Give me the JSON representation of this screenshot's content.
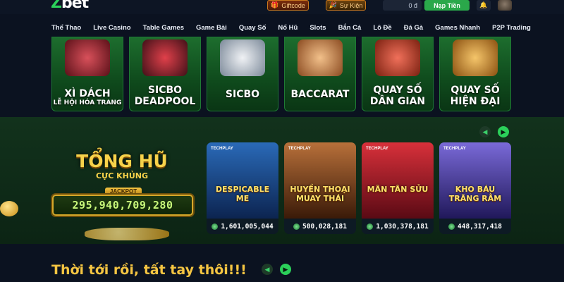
{
  "header": {
    "logo_prefix": "Z",
    "logo_text": "bet",
    "giftcode_label": "Giftcode",
    "sukien_label": "Sự Kiện",
    "balance": "0 đ",
    "naptien_label": "Nạp Tiền"
  },
  "nav": [
    "Thể Thao",
    "Live Casino",
    "Table Games",
    "Game Bài",
    "Quay Số",
    "Nổ Hũ",
    "Slots",
    "Bắn Cá",
    "Lô Đề",
    "Đá Gà",
    "Games Nhanh",
    "P2P Trading"
  ],
  "tiles": [
    {
      "title": "XÌ DÁCH",
      "sub": "LỄ HỘI HÓA TRANG",
      "color": "#b8323a"
    },
    {
      "title": "SICBO DEADPOOL",
      "sub": "",
      "color": "#c0202a"
    },
    {
      "title": "SICBO",
      "sub": "",
      "color": "#d8dde3"
    },
    {
      "title": "BACCARAT",
      "sub": "",
      "color": "#e3a66a"
    },
    {
      "title": "QUAY SỐ DÂN GIAN",
      "sub": "",
      "color": "#e05a3a"
    },
    {
      "title": "QUAY SỐ HIỆN ĐẠI",
      "sub": "",
      "color": "#e8a13a"
    }
  ],
  "jackpot": {
    "title": "TỔNG HŨ",
    "subtitle": "CỰC KHỦNG",
    "tag": "JACKPOT",
    "amount": "295,940,709,280"
  },
  "slots": [
    {
      "provider": "TECHPLAY",
      "name": "DESPICABLE ME",
      "amount": "1,601,005,044",
      "color": "#1c4a8a"
    },
    {
      "provider": "TECHPLAY",
      "name": "HUYỀN THOẠI MUAY THÁI",
      "amount": "500,028,181",
      "color": "#7a3a18"
    },
    {
      "provider": "TECHPLAY",
      "name": "MÃN TÂN SỬU",
      "amount": "1,030,378,181",
      "color": "#a81c2a"
    },
    {
      "provider": "TECHPLAY",
      "name": "KHO BÁU TRĂNG RẰM",
      "amount": "448,317,418",
      "color": "#4a3aa8"
    }
  ],
  "promo_text": "Thời tới rồi, tất tay thôi!!!"
}
